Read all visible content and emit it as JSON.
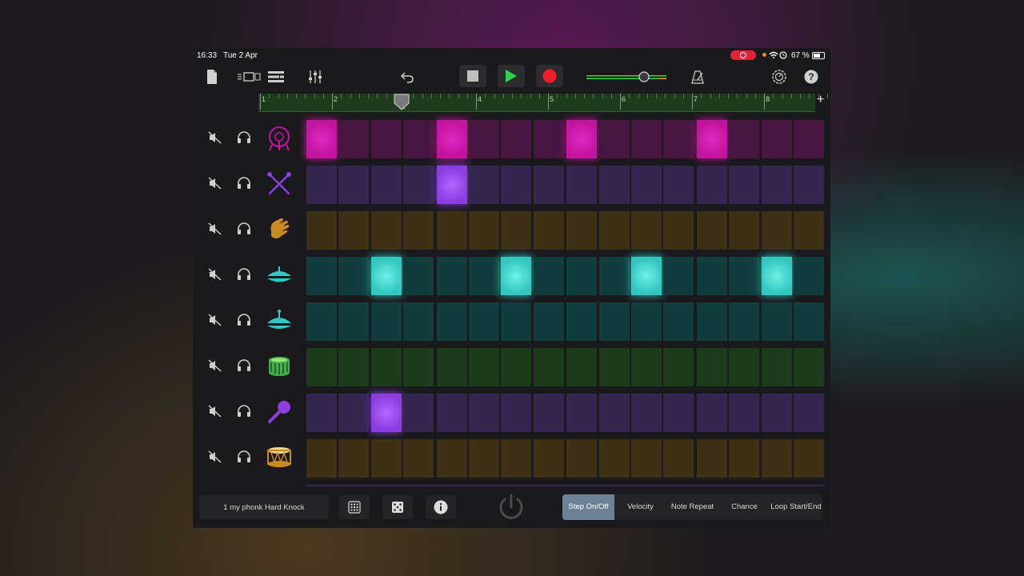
{
  "status": {
    "time": "16:33",
    "date": "Tue 2 Apr",
    "battery": "67 %"
  },
  "ruler": {
    "bars": [
      "1",
      "2",
      "3",
      "4",
      "5",
      "6",
      "7",
      "8"
    ]
  },
  "tracks": [
    {
      "icon": "kick-drum-icon",
      "color": "#c2149e",
      "dim": "#46163f",
      "steps": [
        1,
        0,
        0,
        0,
        1,
        0,
        0,
        0,
        1,
        0,
        0,
        0,
        1,
        0,
        0,
        0
      ]
    },
    {
      "icon": "drumsticks-icon",
      "color": "#8b3de0",
      "dim": "#34264f",
      "steps": [
        0,
        0,
        0,
        0,
        1,
        0,
        0,
        0,
        0,
        0,
        0,
        0,
        0,
        0,
        0,
        0
      ]
    },
    {
      "icon": "clap-icon",
      "color": "#c98a1e",
      "dim": "#3d3116",
      "steps": [
        0,
        0,
        0,
        0,
        0,
        0,
        0,
        0,
        0,
        0,
        0,
        0,
        0,
        0,
        0,
        0
      ]
    },
    {
      "icon": "hihat-icon",
      "color": "#32c7c0",
      "dim": "#113e3c",
      "steps": [
        0,
        0,
        1,
        0,
        0,
        0,
        1,
        0,
        0,
        0,
        1,
        0,
        0,
        0,
        1,
        0
      ]
    },
    {
      "icon": "cymbal-icon",
      "color": "#32c7c0",
      "dim": "#113e3c",
      "steps": [
        0,
        0,
        0,
        0,
        0,
        0,
        0,
        0,
        0,
        0,
        0,
        0,
        0,
        0,
        0,
        0
      ]
    },
    {
      "icon": "snare-drum-icon",
      "color": "#3fb04a",
      "dim": "#1d3a1c",
      "steps": [
        0,
        0,
        0,
        0,
        0,
        0,
        0,
        0,
        0,
        0,
        0,
        0,
        0,
        0,
        0,
        0
      ]
    },
    {
      "icon": "maraca-icon",
      "color": "#8b3de0",
      "dim": "#34264f",
      "steps": [
        0,
        0,
        1,
        0,
        0,
        0,
        0,
        0,
        0,
        0,
        0,
        0,
        0,
        0,
        0,
        0
      ]
    },
    {
      "icon": "tom-drum-icon",
      "color": "#c98a1e",
      "dim": "#3d3116",
      "steps": [
        0,
        0,
        0,
        0,
        0,
        0,
        0,
        0,
        0,
        0,
        0,
        0,
        0,
        0,
        0,
        0
      ]
    }
  ],
  "bottom": {
    "pattern_name": "1 my phonk Hard Knock",
    "modes": [
      "Step On/Off",
      "Velocity",
      "Note Repeat",
      "Chance",
      "Loop Start/End"
    ]
  }
}
